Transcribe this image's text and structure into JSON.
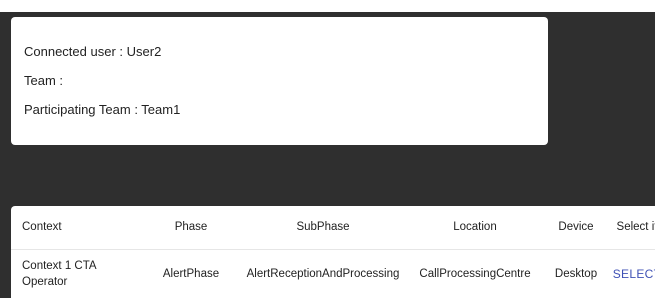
{
  "user_info": {
    "connected_user": "Connected user : User2",
    "team": "Team :",
    "participating_team": "Participating Team : Team1"
  },
  "table": {
    "headers": {
      "context": "Context",
      "phase": "Phase",
      "subphase": "SubPhase",
      "location": "Location",
      "device": "Device",
      "select": "Select it"
    },
    "rows": [
      {
        "context": "Context 1 CTA Operator",
        "phase": "AlertPhase",
        "subphase": "AlertReceptionAndProcessing",
        "location": "CallProcessingCentre",
        "device": "Desktop",
        "action": "SELECT"
      }
    ]
  },
  "colors": {
    "background": "#2f2f2f",
    "card": "#ffffff",
    "accent_link": "#3f51b5"
  }
}
